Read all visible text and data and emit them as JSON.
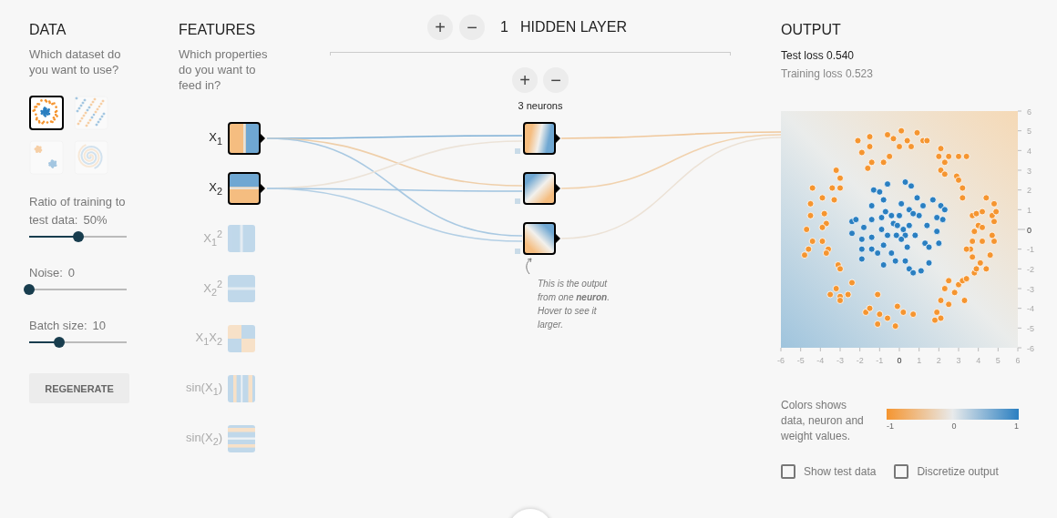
{
  "data_panel": {
    "title": "DATA",
    "subtitle": "Which dataset do you want to use?",
    "datasets": [
      {
        "kind": "circle",
        "selected": true
      },
      {
        "kind": "xor",
        "selected": false
      },
      {
        "kind": "gaussian",
        "selected": false
      },
      {
        "kind": "spiral",
        "selected": false
      }
    ],
    "sliders": [
      {
        "label": "Ratio of training to test data:",
        "value": "50%",
        "level": 0.5
      },
      {
        "label": "Noise:",
        "value": "0",
        "level": 0
      },
      {
        "label": "Batch size:",
        "value": "10",
        "level": 0.31
      }
    ],
    "regenerate_button": "REGENERATE"
  },
  "features_panel": {
    "title": "FEATURES",
    "subtitle": "Which properties do you want to feed in?",
    "features": [
      {
        "label": "X$_{1}$",
        "kind": "x1",
        "on": true
      },
      {
        "label": "X$_{2}$",
        "kind": "x2",
        "on": true
      },
      {
        "label": "X$_{1}$$^{2}$",
        "kind": "x1sq",
        "on": false
      },
      {
        "label": "X$_{2}$$^{2}$",
        "kind": "x2sq",
        "on": false
      },
      {
        "label": "X$_{1}$X$_{2}$",
        "kind": "x1x2",
        "on": false
      },
      {
        "label": "sin(X$_{1}$)",
        "kind": "sinx1",
        "on": false
      },
      {
        "label": "sin(X$_{2}$)",
        "kind": "sinx2",
        "on": false
      }
    ]
  },
  "network": {
    "add_layer_button": "+",
    "remove_layer_button": "−",
    "layer_count": "1",
    "layer_label": "HIDDEN LAYER",
    "add_neuron_button": "+",
    "remove_neuron_button": "−",
    "neuron_count": "3 neurons",
    "neurons": [
      {
        "kind": "vertical"
      },
      {
        "kind": "falling"
      },
      {
        "kind": "rising"
      }
    ],
    "links": [
      {
        "color": "#7fb0d6"
      },
      {
        "color": "#efcfaa"
      },
      {
        "color": "#a9c9e2"
      },
      {
        "color": "#ece3d8"
      },
      {
        "color": "#9fc3e0"
      },
      {
        "color": "#b3cfe5"
      }
    ],
    "output_links": [
      {
        "color": "#f0c89c"
      },
      {
        "color": "#f1d2ae"
      },
      {
        "color": "#ece2d6"
      }
    ],
    "annotation": "This is the output from one **neuron**. Hover to see it larger."
  },
  "output": {
    "title": "OUTPUT",
    "test_loss": "Test loss 0.540",
    "training_loss": "Training loss 0.523",
    "chart_data": {
      "type": "scatter",
      "xlim": [
        -6,
        6
      ],
      "ylim": [
        -6,
        6
      ],
      "xticks": [
        {
          "value": -6,
          "label": "-6"
        },
        {
          "value": -5,
          "label": "-5"
        },
        {
          "value": -4,
          "label": "-4"
        },
        {
          "value": -3,
          "label": "-3"
        },
        {
          "value": -2,
          "label": "-2"
        },
        {
          "value": -1,
          "label": "-1"
        },
        {
          "value": 0,
          "label": "0"
        },
        {
          "value": 1,
          "label": "1"
        },
        {
          "value": 2,
          "label": "2"
        },
        {
          "value": 3,
          "label": "3"
        },
        {
          "value": 4,
          "label": "4"
        },
        {
          "value": 5,
          "label": "5"
        },
        {
          "value": 6,
          "label": "6"
        }
      ],
      "yticks": [
        {
          "value": -6,
          "label": "-6"
        },
        {
          "value": -5,
          "label": "-5"
        },
        {
          "value": -4,
          "label": "-4"
        },
        {
          "value": -3,
          "label": "-3"
        },
        {
          "value": -2,
          "label": "-2"
        },
        {
          "value": -1,
          "label": "-1"
        },
        {
          "value": 0,
          "label": "0"
        },
        {
          "value": 1,
          "label": "1"
        },
        {
          "value": 2,
          "label": "2"
        },
        {
          "value": 3,
          "label": "3"
        },
        {
          "value": 4,
          "label": "4"
        },
        {
          "value": 5,
          "label": "5"
        },
        {
          "value": 6,
          "label": "6"
        }
      ],
      "series": [
        {
          "color": "#2a7fc1",
          "x": [
            0.3,
            -0.6,
            0.3,
            0.6,
            -1.3,
            -1.0,
            -0.8,
            0.9,
            1.7,
            1.2,
            2.1,
            2.3,
            -1.4,
            -0.7,
            0.1,
            0.5,
            1.0,
            1.9,
            2.2,
            -2.4,
            -2.2,
            -1.4,
            -0.9,
            -0.4,
            0.0,
            0.7,
            -1.8,
            -0.9,
            -0.3,
            0.5,
            1.4,
            1.9,
            -2.4,
            -1.9,
            -1.4,
            -0.6,
            0.1,
            0.8,
            1.3,
            2.0,
            -1.9,
            -1.4,
            -0.8,
            -0.4,
            0.4,
            1.5,
            -1.9,
            -1.1,
            -0.2,
            0.3,
            -0.8,
            0.5,
            0.7,
            1.1,
            1.5,
            -0.15,
            0.2,
            -0.1
          ],
          "values": [
            -0.3,
            2.3,
            2.4,
            2.2,
            2,
            1.9,
            1.5,
            1.6,
            1.5,
            1.2,
            1.2,
            1,
            1.2,
            0.9,
            1.3,
            1.0,
            0.7,
            0.6,
            0.5,
            0.4,
            0.5,
            0.5,
            0.6,
            0.7,
            0.7,
            0.8,
            0.1,
            0.0,
            0.3,
            0.2,
            0.2,
            -0.1,
            -0.2,
            -0.5,
            -0.4,
            -0.3,
            -0.5,
            -0.3,
            -0.7,
            -0.7,
            -1.0,
            -1.0,
            -0.8,
            -1.2,
            -0.9,
            -0.9,
            -1.5,
            -1.2,
            -1.6,
            -1.6,
            -1.8,
            -2.0,
            -2.2,
            -2.1,
            -1.7,
            -0.3,
            0.0,
            0.2
          ]
        },
        {
          "color": "#f59530",
          "x": [
            0.1,
            -0.6,
            -1.5,
            -2.1,
            -1.5,
            -1.9,
            -0.3,
            0.4,
            0.9,
            1.2,
            1.4,
            0.6,
            0.0,
            2.1,
            2.0,
            2.5,
            3.0,
            3.4,
            2.3,
            -1.4,
            -0.8,
            -0.5,
            -1.6,
            2.1,
            2.3,
            2.9,
            3.0,
            3.2,
            3.2,
            -3.2,
            -3.0,
            -3.4,
            -3.0,
            -4.4,
            -3.9,
            -3.3,
            -4.5,
            -4.5,
            -3.8,
            -3.7,
            -3.9,
            -4.7,
            -4.4,
            -3.9,
            -4.6,
            -4.8,
            -3.6,
            -3.7,
            -3.1,
            -3.0,
            -2.4,
            -3.2,
            -3.5,
            -3.0,
            -2.6,
            -3.0,
            -1.1,
            -1.7,
            -1.5,
            -1.0,
            -0.6,
            -0.1,
            0.2,
            0.7,
            -0.2,
            -1.1,
            1.8,
            2.1,
            1.9,
            2.1,
            2.5,
            2.3,
            2.5,
            3.0,
            3.2,
            3.4,
            3.3,
            2.8,
            3.8,
            3.9,
            4.1,
            4.4,
            4.6,
            3.7,
            3.6,
            3.4,
            3.7,
            4.2,
            4.8,
            4.7,
            3.8,
            4.0,
            4.2,
            4.7,
            3.7,
            3.9,
            4.2,
            4.9,
            4.8,
            4.4,
            4.8
          ],
          "values": [
            5.0,
            4.8,
            4.7,
            4.5,
            4.2,
            3.9,
            4.6,
            4.5,
            4.9,
            4.5,
            4.5,
            4.2,
            4.2,
            4.1,
            3.7,
            3.7,
            3.7,
            3.7,
            3.4,
            3.4,
            3.4,
            3.7,
            3.1,
            3.0,
            2.8,
            2.7,
            2.5,
            2.1,
            1.6,
            3.0,
            2.6,
            2.1,
            2.1,
            2.1,
            1.6,
            1.5,
            1.3,
            0.7,
            0.8,
            0.3,
            0.1,
            0.0,
            -0.6,
            -0.6,
            -1.0,
            -1.3,
            -1.0,
            -1.2,
            -1.8,
            -2.0,
            -2.7,
            -3.0,
            -3.3,
            -3.4,
            -3.3,
            -3.6,
            -3.3,
            -4.2,
            -4.0,
            -4.3,
            -4.5,
            -3.9,
            -4.2,
            -4.3,
            -4.9,
            -4.8,
            -4.6,
            -4.5,
            -4.2,
            -3.6,
            -3.8,
            -3.0,
            -2.6,
            -2.8,
            -2.6,
            -2.5,
            -3.6,
            -3.2,
            -2.2,
            -2.0,
            -1.7,
            -2.0,
            -1.3,
            -1.4,
            -1.0,
            -1.0,
            -0.6,
            -0.6,
            -0.6,
            -0.3,
            -0.1,
            0.2,
            0.1,
            0.7,
            0.7,
            0.8,
            0.9,
            0.9,
            1.3,
            1.6,
            0.4
          ]
        }
      ]
    },
    "legend_text": "Colors shows data, neuron and weight values.",
    "legend_ticks": [
      "-1",
      "0",
      "1"
    ],
    "checkboxes": [
      {
        "label": "Show test data",
        "checked": false
      },
      {
        "label": "Discretize output",
        "checked": false
      }
    ]
  }
}
